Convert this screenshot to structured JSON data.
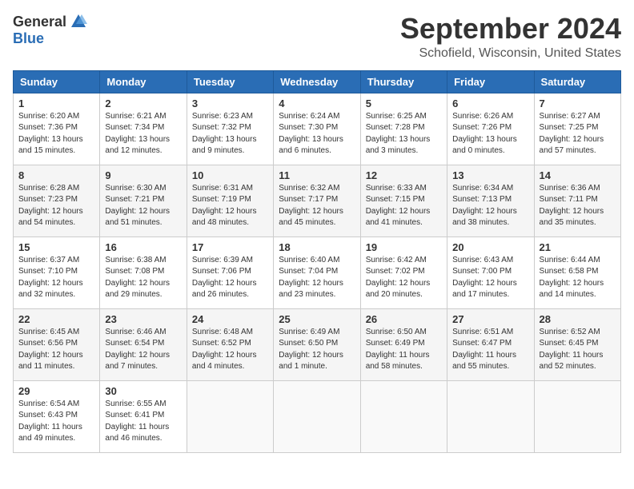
{
  "header": {
    "logo_general": "General",
    "logo_blue": "Blue",
    "month_title": "September 2024",
    "location": "Schofield, Wisconsin, United States"
  },
  "days_of_week": [
    "Sunday",
    "Monday",
    "Tuesday",
    "Wednesday",
    "Thursday",
    "Friday",
    "Saturday"
  ],
  "weeks": [
    [
      {
        "day": "1",
        "sunrise": "6:20 AM",
        "sunset": "7:36 PM",
        "daylight": "13 hours and 15 minutes."
      },
      {
        "day": "2",
        "sunrise": "6:21 AM",
        "sunset": "7:34 PM",
        "daylight": "13 hours and 12 minutes."
      },
      {
        "day": "3",
        "sunrise": "6:23 AM",
        "sunset": "7:32 PM",
        "daylight": "13 hours and 9 minutes."
      },
      {
        "day": "4",
        "sunrise": "6:24 AM",
        "sunset": "7:30 PM",
        "daylight": "13 hours and 6 minutes."
      },
      {
        "day": "5",
        "sunrise": "6:25 AM",
        "sunset": "7:28 PM",
        "daylight": "13 hours and 3 minutes."
      },
      {
        "day": "6",
        "sunrise": "6:26 AM",
        "sunset": "7:26 PM",
        "daylight": "13 hours and 0 minutes."
      },
      {
        "day": "7",
        "sunrise": "6:27 AM",
        "sunset": "7:25 PM",
        "daylight": "12 hours and 57 minutes."
      }
    ],
    [
      {
        "day": "8",
        "sunrise": "6:28 AM",
        "sunset": "7:23 PM",
        "daylight": "12 hours and 54 minutes."
      },
      {
        "day": "9",
        "sunrise": "6:30 AM",
        "sunset": "7:21 PM",
        "daylight": "12 hours and 51 minutes."
      },
      {
        "day": "10",
        "sunrise": "6:31 AM",
        "sunset": "7:19 PM",
        "daylight": "12 hours and 48 minutes."
      },
      {
        "day": "11",
        "sunrise": "6:32 AM",
        "sunset": "7:17 PM",
        "daylight": "12 hours and 45 minutes."
      },
      {
        "day": "12",
        "sunrise": "6:33 AM",
        "sunset": "7:15 PM",
        "daylight": "12 hours and 41 minutes."
      },
      {
        "day": "13",
        "sunrise": "6:34 AM",
        "sunset": "7:13 PM",
        "daylight": "12 hours and 38 minutes."
      },
      {
        "day": "14",
        "sunrise": "6:36 AM",
        "sunset": "7:11 PM",
        "daylight": "12 hours and 35 minutes."
      }
    ],
    [
      {
        "day": "15",
        "sunrise": "6:37 AM",
        "sunset": "7:10 PM",
        "daylight": "12 hours and 32 minutes."
      },
      {
        "day": "16",
        "sunrise": "6:38 AM",
        "sunset": "7:08 PM",
        "daylight": "12 hours and 29 minutes."
      },
      {
        "day": "17",
        "sunrise": "6:39 AM",
        "sunset": "7:06 PM",
        "daylight": "12 hours and 26 minutes."
      },
      {
        "day": "18",
        "sunrise": "6:40 AM",
        "sunset": "7:04 PM",
        "daylight": "12 hours and 23 minutes."
      },
      {
        "day": "19",
        "sunrise": "6:42 AM",
        "sunset": "7:02 PM",
        "daylight": "12 hours and 20 minutes."
      },
      {
        "day": "20",
        "sunrise": "6:43 AM",
        "sunset": "7:00 PM",
        "daylight": "12 hours and 17 minutes."
      },
      {
        "day": "21",
        "sunrise": "6:44 AM",
        "sunset": "6:58 PM",
        "daylight": "12 hours and 14 minutes."
      }
    ],
    [
      {
        "day": "22",
        "sunrise": "6:45 AM",
        "sunset": "6:56 PM",
        "daylight": "12 hours and 11 minutes."
      },
      {
        "day": "23",
        "sunrise": "6:46 AM",
        "sunset": "6:54 PM",
        "daylight": "12 hours and 7 minutes."
      },
      {
        "day": "24",
        "sunrise": "6:48 AM",
        "sunset": "6:52 PM",
        "daylight": "12 hours and 4 minutes."
      },
      {
        "day": "25",
        "sunrise": "6:49 AM",
        "sunset": "6:50 PM",
        "daylight": "12 hours and 1 minute."
      },
      {
        "day": "26",
        "sunrise": "6:50 AM",
        "sunset": "6:49 PM",
        "daylight": "11 hours and 58 minutes."
      },
      {
        "day": "27",
        "sunrise": "6:51 AM",
        "sunset": "6:47 PM",
        "daylight": "11 hours and 55 minutes."
      },
      {
        "day": "28",
        "sunrise": "6:52 AM",
        "sunset": "6:45 PM",
        "daylight": "11 hours and 52 minutes."
      }
    ],
    [
      {
        "day": "29",
        "sunrise": "6:54 AM",
        "sunset": "6:43 PM",
        "daylight": "11 hours and 49 minutes."
      },
      {
        "day": "30",
        "sunrise": "6:55 AM",
        "sunset": "6:41 PM",
        "daylight": "11 hours and 46 minutes."
      },
      {
        "day": "",
        "sunrise": "",
        "sunset": "",
        "daylight": ""
      },
      {
        "day": "",
        "sunrise": "",
        "sunset": "",
        "daylight": ""
      },
      {
        "day": "",
        "sunrise": "",
        "sunset": "",
        "daylight": ""
      },
      {
        "day": "",
        "sunrise": "",
        "sunset": "",
        "daylight": ""
      },
      {
        "day": "",
        "sunrise": "",
        "sunset": "",
        "daylight": ""
      }
    ]
  ]
}
